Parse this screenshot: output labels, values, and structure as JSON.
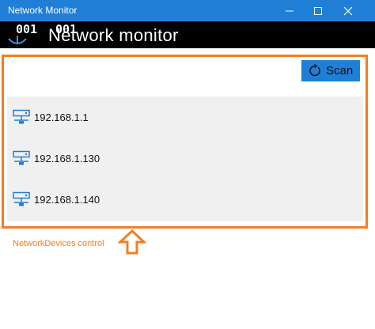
{
  "window": {
    "title": "Network Monitor",
    "controls": [
      "minimize-icon",
      "maximize-icon",
      "close-icon"
    ]
  },
  "header": {
    "title": "Network monitor",
    "counters": [
      "001",
      "001"
    ],
    "icon": "network-icon"
  },
  "toolbar": {
    "scan_label": "Scan",
    "scan_icon": "refresh-icon"
  },
  "devices": [
    {
      "ip": "192.168.1.1",
      "icon": "network-device-icon"
    },
    {
      "ip": "192.168.1.130",
      "icon": "network-device-icon"
    },
    {
      "ip": "192.168.1.140",
      "icon": "network-device-icon"
    }
  ],
  "annotation": {
    "caption": "NetworkDevices control",
    "arrow_icon": "arrow-up-icon"
  },
  "colors": {
    "accent": "#1f7fd6",
    "annotation": "#f07f23",
    "header_bg": "#000000",
    "list_bg": "#f0f0f0"
  }
}
